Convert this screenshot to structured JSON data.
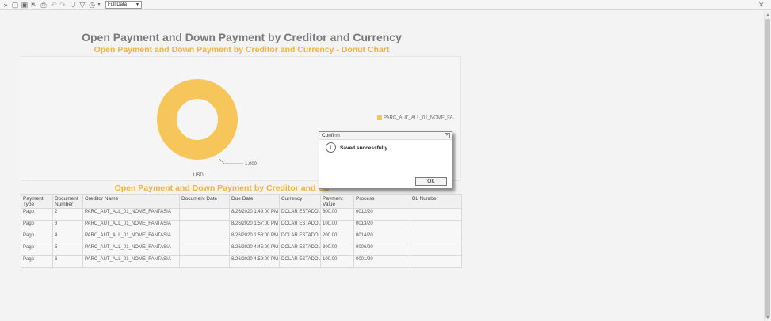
{
  "toolbar": {
    "data_mode": "Full Data",
    "icons": [
      "expand-icon",
      "save-icon",
      "save-as-icon",
      "export-icon",
      "print-icon",
      "undo-icon",
      "redo-icon",
      "filter-icon",
      "filter-icon",
      "clock-icon"
    ]
  },
  "report": {
    "title": "Open Payment and Down Payment by Creditor and Currency",
    "chart_subtitle": "Open Payment and Down Payment by Creditor and Currency -  Donut Chart",
    "table_title": "Open Payment and Down Payment by Creditor and Cu"
  },
  "chart_data": {
    "type": "pie",
    "donut": true,
    "labels": [
      "USD"
    ],
    "values": [
      1000
    ],
    "value_label": "1,000",
    "category_label": "USD",
    "legend": [
      "PARC_AUT_ALL_01_NOME_FA..."
    ],
    "colors": [
      "#f7c65a"
    ],
    "legend_position": "right"
  },
  "table": {
    "headers": [
      "Payment Type",
      "Document Number",
      "Creditor  Name",
      "Document Date",
      "Due Date",
      "Currency",
      "Payment Value",
      "Process",
      "BL Number"
    ],
    "rows": [
      [
        "Pago",
        "2",
        "PARC_AUT_ALL_01_NOME_FANTASIA",
        "",
        "8/26/2020 1:49:00 PM",
        "DÓLAR ESTADOUNIDENSE",
        "300.00",
        "0012/20",
        ""
      ],
      [
        "Pago",
        "3",
        "PARC_AUT_ALL_01_NOME_FANTASIA",
        "",
        "8/26/2020 1:57:00 PM",
        "DÓLAR ESTADOUNIDENSE",
        "100.00",
        "0013/20",
        ""
      ],
      [
        "Pago",
        "4",
        "PARC_AUT_ALL_01_NOME_FANTASIA",
        "",
        "8/26/2020 1:58:00 PM",
        "DÓLAR ESTADOUNIDENSE",
        "200.00",
        "0014/20",
        ""
      ],
      [
        "Pago",
        "5",
        "PARC_AUT_ALL_01_NOME_FANTASIA",
        "",
        "8/26/2020 4:45:00 PM",
        "DÓLAR ESTADOUNIDENSE",
        "300.00",
        "0006/20",
        ""
      ],
      [
        "Pago",
        "6",
        "PARC_AUT_ALL_01_NOME_FANTASIA",
        "",
        "8/26/2020 4:59:00 PM",
        "DÓLAR ESTADOUNIDENSE",
        "100.00",
        "0001/20",
        ""
      ]
    ]
  },
  "dialog": {
    "title": "Confirm",
    "message": "Saved successfully.",
    "ok_label": "OK",
    "info_glyph": "i"
  }
}
